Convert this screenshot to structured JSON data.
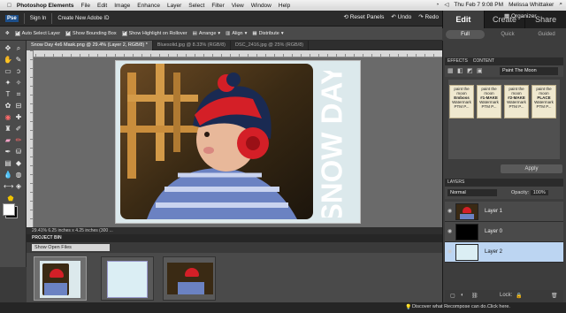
{
  "menubar": {
    "app_name": "Photoshop Elements",
    "items": [
      "File",
      "Edit",
      "Image",
      "Enhance",
      "Layer",
      "Select",
      "Filter",
      "View",
      "Window",
      "Help"
    ],
    "clock": "Thu Feb 7  9:08 PM",
    "user": "Melissa Whittaker"
  },
  "appbar": {
    "sign_in": "Sign In",
    "create_id": "Create New Adobe ID",
    "reset_panels": "Reset Panels",
    "undo": "Undo",
    "redo": "Redo",
    "organizer": "Organizer"
  },
  "mode_tabs": [
    "Edit",
    "Create",
    "Share"
  ],
  "sub_tabs": [
    "Full",
    "Quick",
    "Guided"
  ],
  "options": {
    "auto_select": "Auto Select Layer",
    "bounding_box": "Show Bounding Box",
    "highlight": "Show Highlight on Rollover",
    "arrange": "Arrange",
    "align": "Align",
    "distribute": "Distribute"
  },
  "doc_tabs": [
    "Snow Day 4x6 Mask.png @ 29.4% (Layer 2, RGB/8) *",
    "Bluesolid.jpg @ 8.33% (RGB/8)",
    "DSC_2416.jpg @ 25% (RGB/8)"
  ],
  "canvas": {
    "card_text": "SNOW DAY"
  },
  "status": {
    "text": "29.41%   6.25 inches x 4.25 inches (300 ..."
  },
  "project_bin": {
    "header": "PROJECT BIN",
    "filter": "Show Open Files"
  },
  "effects": {
    "tabs": [
      "EFFECTS",
      "CONTENT"
    ],
    "dropdown": "Paint The Moon",
    "thumbs": [
      [
        "paint the",
        "moon",
        "Emboss",
        "Watermark",
        "PTM P..."
      ],
      [
        "paint the",
        "moon",
        "#1-MAKE",
        "Watermark",
        "PTM P..."
      ],
      [
        "paint the",
        "moon",
        "#2-MAKE",
        "Watermark",
        "PTM P..."
      ],
      [
        "paint the",
        "moon",
        "PLACE",
        "Watermark",
        "PTM P..."
      ]
    ],
    "apply": "Apply"
  },
  "layers": {
    "header": "LAYERS",
    "blend_mode": "Normal",
    "opacity_label": "Opacity:",
    "opacity_value": "100%",
    "items": [
      "Layer 1",
      "Layer 0",
      "Layer 2"
    ],
    "lock_label": "Lock:"
  },
  "tip": "Discover what Recompose can do.Click here.",
  "colors": {
    "accent": "#bcd5f2",
    "hat_red": "#d41f27",
    "card_bg": "#dce9ec"
  }
}
